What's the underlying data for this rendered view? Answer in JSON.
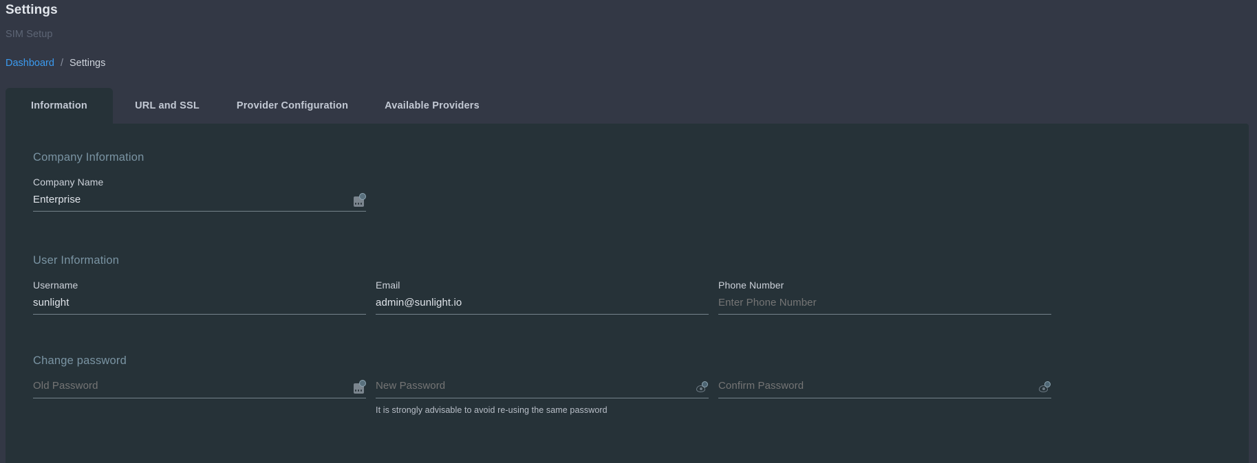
{
  "header": {
    "title": "Settings",
    "subtitle": "SIM Setup",
    "breadcrumb": {
      "link": "Dashboard",
      "separator": "/",
      "current": "Settings"
    }
  },
  "tabs": [
    {
      "label": "Information",
      "active": true
    },
    {
      "label": "URL and SSL",
      "active": false
    },
    {
      "label": "Provider Configuration",
      "active": false
    },
    {
      "label": "Available Providers",
      "active": false
    }
  ],
  "sections": {
    "company": {
      "title": "Company Information",
      "fields": [
        {
          "label": "Company Name",
          "value": "Enterprise",
          "placeholder": "",
          "icon": "keypad-icon"
        }
      ]
    },
    "user": {
      "title": "User Information",
      "fields": [
        {
          "label": "Username",
          "value": "sunlight",
          "placeholder": ""
        },
        {
          "label": "Email",
          "value": "admin@sunlight.io",
          "placeholder": ""
        },
        {
          "label": "Phone Number",
          "value": "",
          "placeholder": "Enter Phone Number"
        }
      ]
    },
    "password": {
      "title": "Change password",
      "fields": [
        {
          "placeholder": "Old Password",
          "value": "",
          "icon": "keypad-icon"
        },
        {
          "placeholder": "New Password",
          "value": "",
          "icon": "eye-icon",
          "hint": "It is strongly advisable to avoid re-using the same password"
        },
        {
          "placeholder": "Confirm Password",
          "value": "",
          "icon": "eye-icon"
        }
      ]
    }
  },
  "colors": {
    "page_background": "#333845",
    "panel_background": "#263238",
    "link": "#3b9bf0",
    "section_heading": "#7a94a3",
    "underline": "#76848c"
  }
}
